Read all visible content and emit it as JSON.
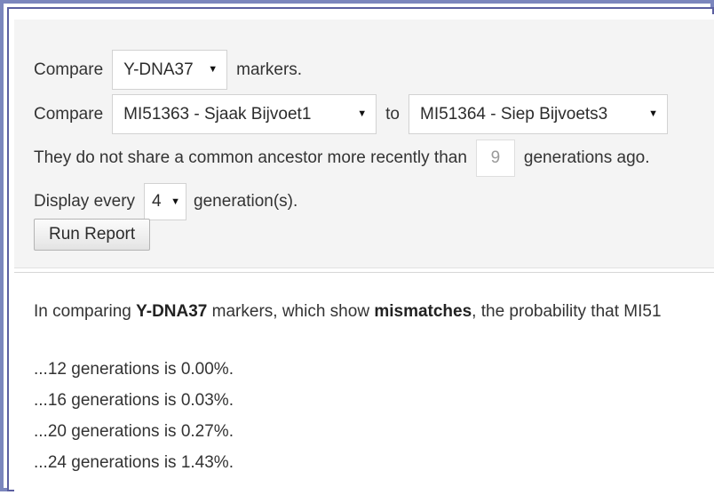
{
  "form": {
    "row_markers": {
      "label_before": "Compare",
      "label_after": "markers.",
      "select_markers": {
        "name": "marker-set",
        "value": "Y-DNA37",
        "arrow": "caret-down-icon"
      }
    },
    "row_kits": {
      "label_before": "Compare",
      "label_between": "to",
      "select_kit_1": {
        "name": "kit-1",
        "value": "MI51363 - Sjaak Bijvoet1",
        "arrow": "caret-down-icon"
      },
      "select_kit_2": {
        "name": "kit-2",
        "value": "MI51364 - Siep Bijvoets3",
        "arrow": "caret-down-icon"
      }
    },
    "row_ancestor": {
      "label_before": "They do not share a common ancestor more recently than",
      "label_after": "generations ago.",
      "generations_input": {
        "value": "9",
        "placeholder": "9"
      }
    },
    "row_display": {
      "label_before": "Display every",
      "label_after": "generation(s).",
      "select_interval": {
        "value": "4",
        "arrow": "caret-down-icon"
      }
    },
    "run_button_label": "Run Report"
  },
  "results": {
    "intro_part_1": "In comparing ",
    "intro_bold_1": "Y-DNA37",
    "intro_part_2": " markers, which show ",
    "intro_bold_2": "mismatches",
    "intro_part_3": ", the probability that MI51",
    "lines": [
      "...12 generations is 0.00%.",
      "...16 generations is 0.03%.",
      "...20 generations is 0.27%.",
      "...24 generations is 1.43%."
    ]
  },
  "colors": {
    "frame_outer": "#7b86bd",
    "frame_inner": "#5b5fa0",
    "panel_bg": "#f4f4f4",
    "text": "#333333"
  }
}
